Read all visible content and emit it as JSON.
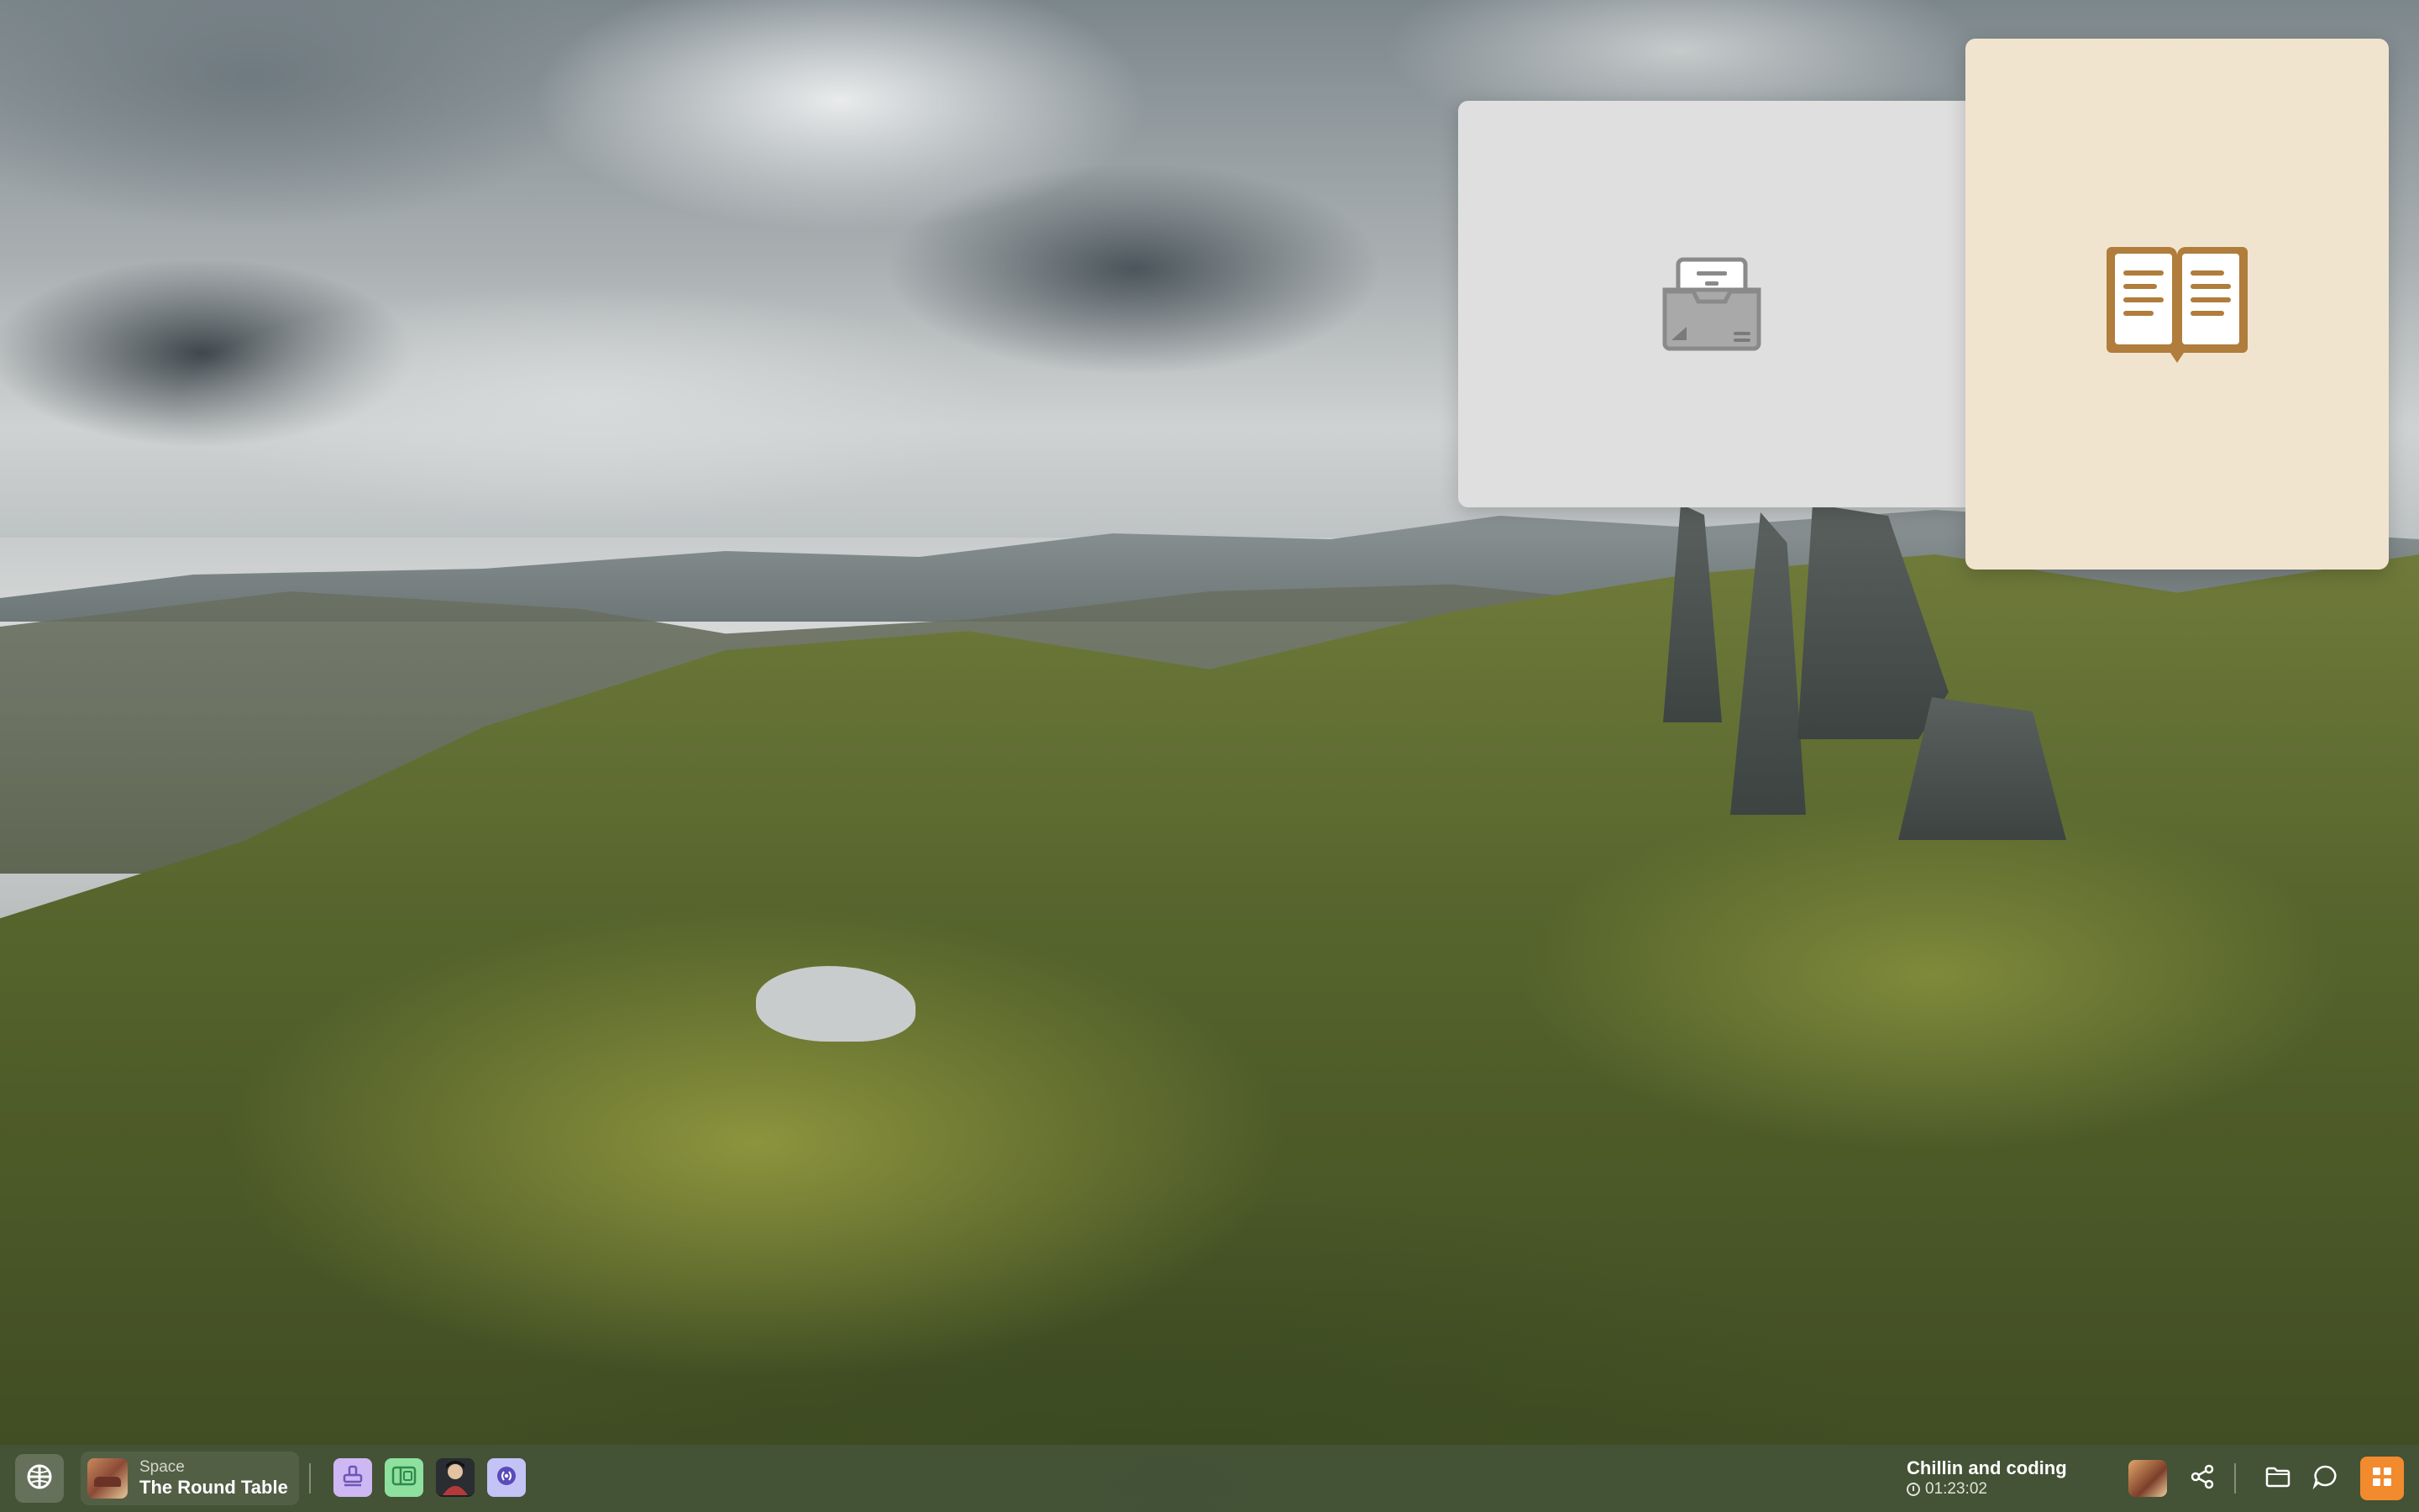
{
  "wallpaper": {
    "description_icon": "landscape-wallpaper"
  },
  "windows": {
    "inbox_tile": {
      "icon": "inbox-tray-icon",
      "background": "#dfdfdf"
    },
    "book_tile": {
      "icon": "open-book-icon",
      "background": "#f1e4ce",
      "accent": "#b07d3c"
    }
  },
  "taskbar": {
    "globe_icon": "globe-icon",
    "space": {
      "kicker": "Space",
      "name": "The Round Table"
    },
    "apps": [
      {
        "icon": "stamp-app-icon",
        "color": "#cdb8f3"
      },
      {
        "icon": "panel-app-icon",
        "color": "#8ee09f"
      },
      {
        "icon": "character-app-icon",
        "color": "#1c1f22"
      },
      {
        "icon": "audio-app-icon",
        "color": "#c4c3f6"
      }
    ],
    "status": {
      "title": "Chillin and coding",
      "elapsed": "01:23:02"
    },
    "accent": "#f28a2e"
  }
}
